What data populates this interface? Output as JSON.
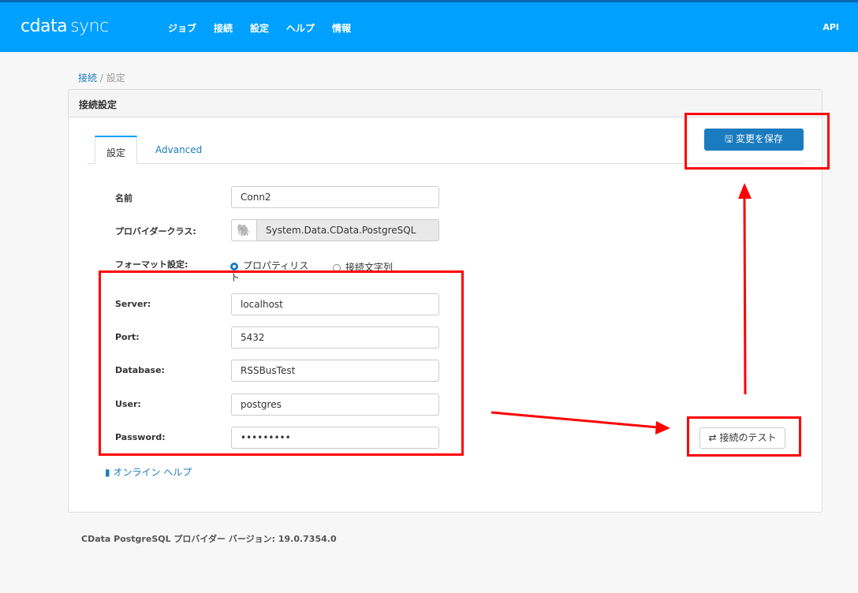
{
  "nav": {
    "logo_main": "cdata",
    "logo_sub": "sync",
    "items": [
      "ジョブ",
      "接続",
      "設定",
      "ヘルプ",
      "情報"
    ],
    "api": "API"
  },
  "breadcrumb": {
    "parent": "接続",
    "sep": "/",
    "current": "設定"
  },
  "panel": {
    "title": "接続設定",
    "tabs": [
      "設定",
      "Advanced"
    ],
    "save_label": "変更を保存",
    "test_label": "接続のテスト",
    "help_label": "オンライン ヘルプ"
  },
  "fields": {
    "name": {
      "label": "名前",
      "value": "Conn2"
    },
    "provider": {
      "label": "プロバイダークラス:",
      "value": "System.Data.CData.PostgreSQL"
    },
    "format": {
      "label": "フォーマット設定:",
      "opt1": "プロパティリスト",
      "opt2": "接続文字列"
    },
    "server": {
      "label": "Server:",
      "value": "localhost"
    },
    "port": {
      "label": "Port:",
      "value": "5432"
    },
    "database": {
      "label": "Database:",
      "value": "RSSBusTest"
    },
    "user": {
      "label": "User:",
      "value": "postgres"
    },
    "password": {
      "label": "Password:",
      "value": "•••••••••"
    }
  },
  "footer": "CData PostgreSQL プロバイダー バージョン: 19.0.7354.0",
  "colors": {
    "nav": "#00a0ff",
    "accent": "#1a7bbf",
    "highlight": "#ff0000"
  }
}
